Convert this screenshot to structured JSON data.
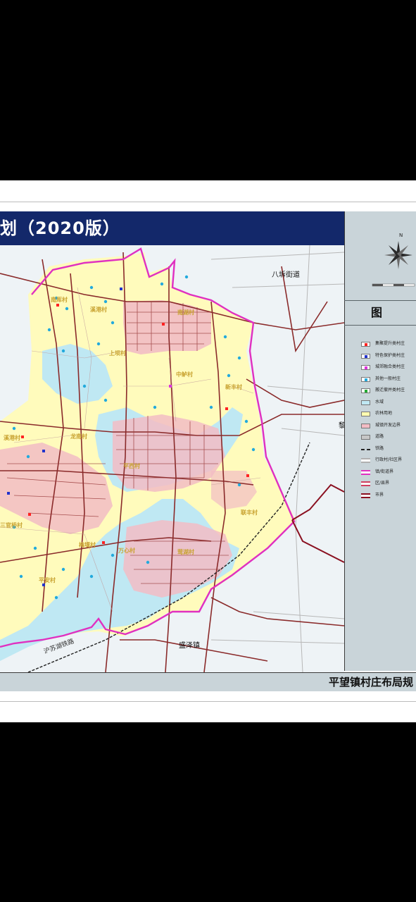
{
  "map_title": "划（2020版）",
  "bottom_title": "平望镇村庄布局规",
  "legend": {
    "title": "图 例",
    "items": [
      {
        "label": "集聚提升类村庄",
        "color": "#ff2222",
        "kind": "dot"
      },
      {
        "label": "特色保护类村庄",
        "color": "#2233cc",
        "kind": "dot"
      },
      {
        "label": "城郊融合类村庄",
        "color": "#dd33dd",
        "kind": "dot"
      },
      {
        "label": "其他一般村庄",
        "color": "#22aadd",
        "kind": "dot"
      },
      {
        "label": "搬迁撤并类村庄",
        "color": "#22aa33",
        "kind": "dot"
      },
      {
        "label": "水域",
        "color": "#bfe8f3",
        "kind": "fill"
      },
      {
        "label": "农林用地",
        "color": "#fffbb0",
        "kind": "fill"
      },
      {
        "label": "城镇开发边界",
        "color": "#f2bcc4",
        "kind": "fill"
      },
      {
        "label": "道路",
        "color": "#c7c7c7",
        "kind": "fill"
      },
      {
        "label": "铁路",
        "color": "#222222",
        "kind": "rail"
      },
      {
        "label": "行政村/社区界",
        "color": "#b0b0b0",
        "kind": "line"
      },
      {
        "label": "镇/街道界",
        "color": "#e030c0",
        "kind": "line"
      },
      {
        "label": "区/县界",
        "color": "#d04060",
        "kind": "line"
      },
      {
        "label": "市界",
        "color": "#8a1020",
        "kind": "line"
      }
    ]
  },
  "compass_label": "N",
  "place_labels": {
    "bahe": "八坼街道",
    "shengze": "盛泽镇",
    "li": "黎"
  },
  "village_labels": [
    {
      "name": "南厍村"
    },
    {
      "name": "溪港村"
    },
    {
      "name": "南湖村"
    },
    {
      "name": "上坝村"
    },
    {
      "name": "中鲈村"
    },
    {
      "name": "新丰村"
    },
    {
      "name": "龙南村"
    },
    {
      "name": "平西村"
    },
    {
      "name": "三官桥村"
    },
    {
      "name": "联丰村"
    },
    {
      "name": "梅堰村"
    },
    {
      "name": "万心村"
    },
    {
      "name": "莺湖村"
    },
    {
      "name": "平安村"
    },
    {
      "name": "溪港村"
    }
  ],
  "road_labels": {
    "expressway": "沪苏湖铁路"
  }
}
